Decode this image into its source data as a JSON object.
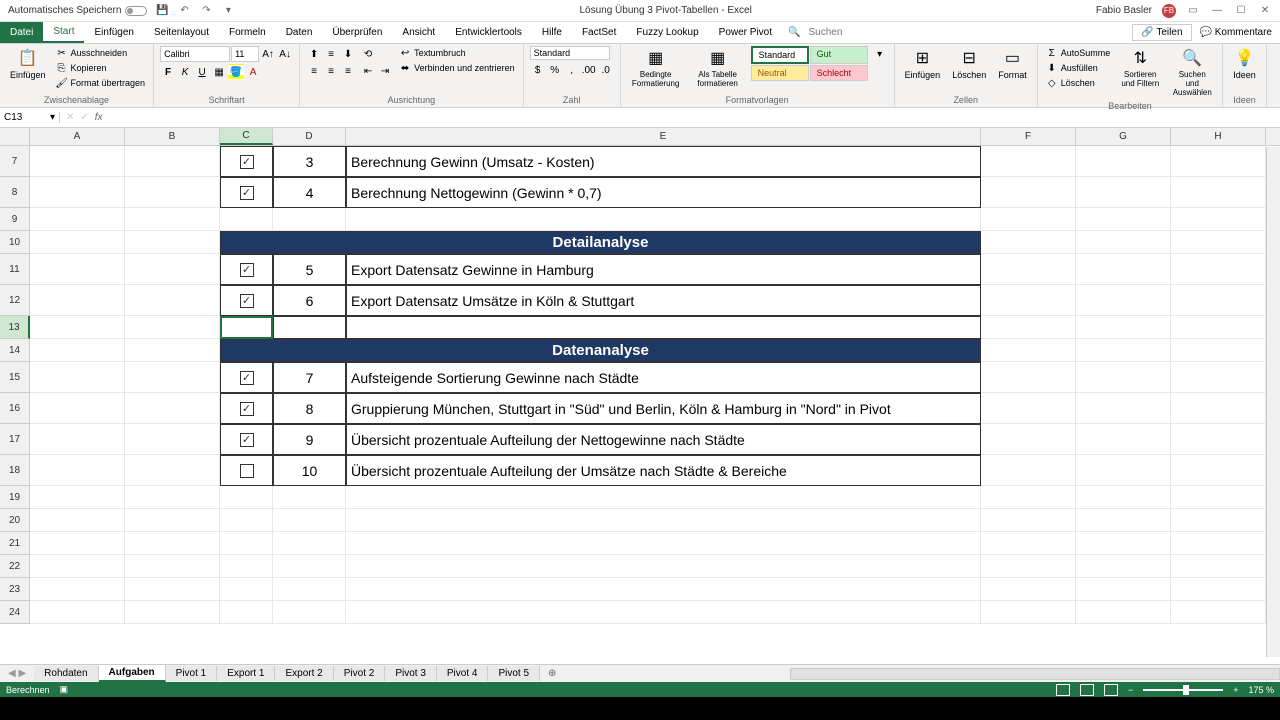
{
  "titlebar": {
    "autosave": "Automatisches Speichern",
    "filename": "Lösung Übung 3 Pivot-Tabellen - Excel",
    "user": "Fabio Basler",
    "user_initials": "FB"
  },
  "ribbon_tabs": {
    "file": "Datei",
    "tabs": [
      "Start",
      "Einfügen",
      "Seitenlayout",
      "Formeln",
      "Daten",
      "Überprüfen",
      "Ansicht",
      "Entwicklertools",
      "Hilfe",
      "FactSet",
      "Fuzzy Lookup",
      "Power Pivot"
    ],
    "search_icon": "🔍",
    "search_placeholder": "Suchen",
    "share": "Teilen",
    "comments": "Kommentare"
  },
  "ribbon": {
    "clipboard": {
      "paste": "Einfügen",
      "cut": "Ausschneiden",
      "copy": "Kopieren",
      "format_painter": "Format übertragen",
      "label": "Zwischenablage"
    },
    "font": {
      "name": "Calibri",
      "size": "11",
      "label": "Schriftart"
    },
    "alignment": {
      "wrap": "Textumbruch",
      "merge": "Verbinden und zentrieren",
      "label": "Ausrichtung"
    },
    "number": {
      "format": "Standard",
      "label": "Zahl"
    },
    "styles": {
      "conditional": "Bedingte Formatierung",
      "as_table": "Als Tabelle formatieren",
      "standard": "Standard",
      "gut": "Gut",
      "neutral": "Neutral",
      "schlecht": "Schlecht",
      "label": "Formatvorlagen"
    },
    "cells": {
      "insert": "Einfügen",
      "delete": "Löschen",
      "format": "Format",
      "label": "Zellen"
    },
    "editing": {
      "autosum": "AutoSumme",
      "fill": "Ausfüllen",
      "clear": "Löschen",
      "sort": "Sortieren und Filtern",
      "find": "Suchen und Auswählen",
      "label": "Bearbeiten"
    },
    "ideas": {
      "label": "Ideen"
    }
  },
  "formula": {
    "cell_ref": "C13",
    "fx": "fx"
  },
  "columns": [
    "A",
    "B",
    "C",
    "D",
    "E",
    "F",
    "G",
    "H"
  ],
  "rows": {
    "r7": {
      "num": "7",
      "d": "3",
      "e": "Berechnung Gewinn (Umsatz - Kosten)",
      "checked": true
    },
    "r8": {
      "num": "8",
      "d": "4",
      "e": "Berechnung Nettogewinn (Gewinn * 0,7)",
      "checked": true
    },
    "r9": {
      "num": "9"
    },
    "r10": {
      "num": "10",
      "header": "Detailanalyse"
    },
    "r11": {
      "num": "11",
      "d": "5",
      "e": "Export Datensatz Gewinne in Hamburg",
      "checked": true
    },
    "r12": {
      "num": "12",
      "d": "6",
      "e": "Export Datensatz Umsätze in Köln & Stuttgart",
      "checked": true
    },
    "r13": {
      "num": "13"
    },
    "r14": {
      "num": "14",
      "header": "Datenanalyse"
    },
    "r15": {
      "num": "15",
      "d": "7",
      "e": "Aufsteigende Sortierung Gewinne nach Städte",
      "checked": true
    },
    "r16": {
      "num": "16",
      "d": "8",
      "e": "Gruppierung München, Stuttgart in \"Süd\" und Berlin, Köln & Hamburg in \"Nord\" in Pivot",
      "checked": true
    },
    "r17": {
      "num": "17",
      "d": "9",
      "e": "Übersicht prozentuale Aufteilung der Nettogewinne nach Städte",
      "checked": true
    },
    "r18": {
      "num": "18",
      "d": "10",
      "e": "Übersicht prozentuale Aufteilung der Umsätze nach Städte & Bereiche",
      "checked": false
    },
    "r19": {
      "num": "19"
    },
    "r20": {
      "num": "20"
    },
    "r21": {
      "num": "21"
    },
    "r22": {
      "num": "22"
    },
    "r23": {
      "num": "23"
    },
    "r24": {
      "num": "24"
    }
  },
  "sheets": [
    "Rohdaten",
    "Aufgaben",
    "Pivot 1",
    "Export 1",
    "Export 2",
    "Pivot 2",
    "Pivot 3",
    "Pivot 4",
    "Pivot 5"
  ],
  "active_sheet": 1,
  "statusbar": {
    "status": "Berechnen",
    "zoom": "175 %"
  }
}
